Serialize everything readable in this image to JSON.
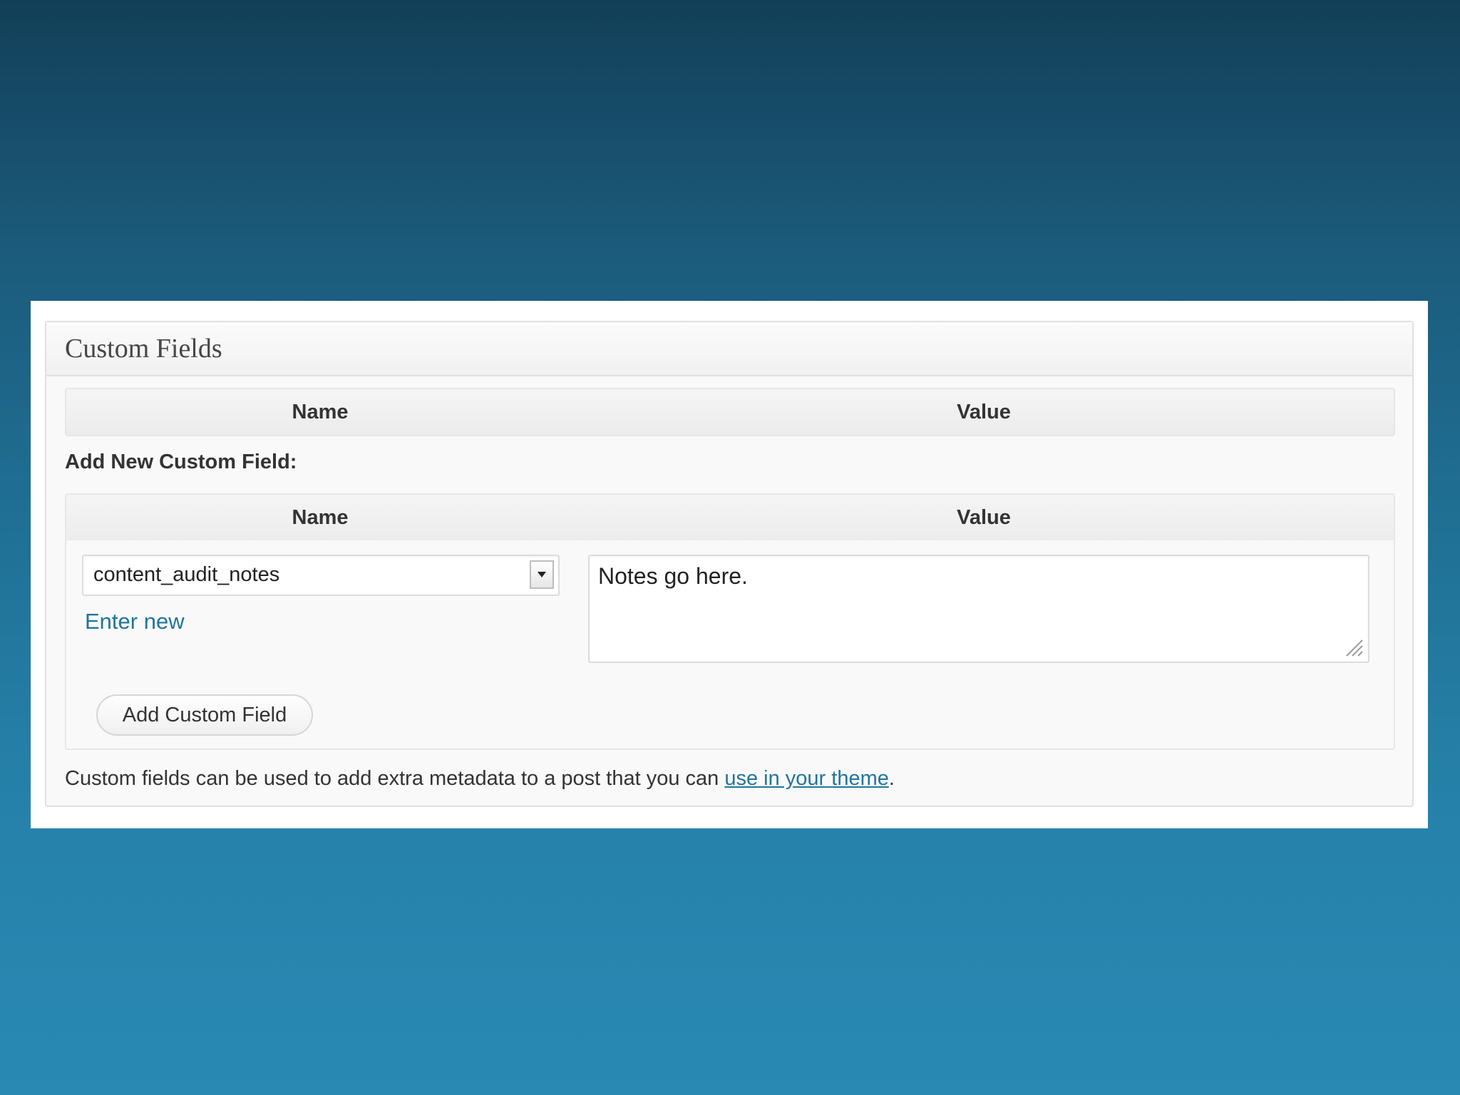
{
  "panel": {
    "title": "Custom Fields",
    "existing_table": {
      "columns": [
        "Name",
        "Value"
      ]
    },
    "add_new": {
      "label": "Add New Custom Field:",
      "columns": [
        "Name",
        "Value"
      ],
      "name_select": {
        "selected": "content_audit_notes"
      },
      "enter_new_link": "Enter new",
      "value_textarea": {
        "value": "Notes go here."
      },
      "submit_button": "Add Custom Field"
    },
    "footer": {
      "text": "Custom fields can be used to add extra metadata to a post that you can",
      "link": "use in your theme",
      "suffix": "."
    }
  },
  "colors": {
    "link": "#21759b",
    "background_top": "#123f58",
    "background_bottom": "#2989b3"
  },
  "icons": {
    "select_arrow": "chevron-down-icon",
    "resize": "resize-grip-icon"
  }
}
